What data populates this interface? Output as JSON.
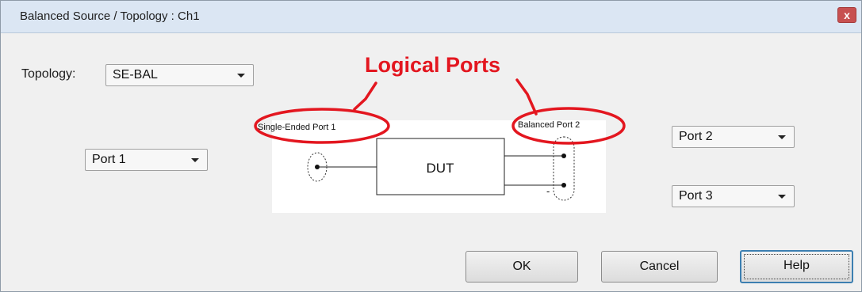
{
  "window": {
    "title": "Balanced Source / Topology : Ch1",
    "close_glyph": "x"
  },
  "topology": {
    "label": "Topology:",
    "value": "SE-BAL"
  },
  "annotation": {
    "heading": "Logical Ports",
    "color": "#e3161f"
  },
  "ports": {
    "left_select": "Port 1",
    "right_top_select": "Port 2",
    "right_bottom_select": "Port 3"
  },
  "diagram": {
    "single_ended_label": "Single-Ended Port 1",
    "balanced_label": "Balanced Port 2",
    "dut_label": "DUT",
    "minus_sign": "-"
  },
  "buttons": {
    "ok": "OK",
    "cancel": "Cancel",
    "help": "Help"
  },
  "icons": {
    "close": "close-icon",
    "dropdown": "chevron-down-icon"
  }
}
